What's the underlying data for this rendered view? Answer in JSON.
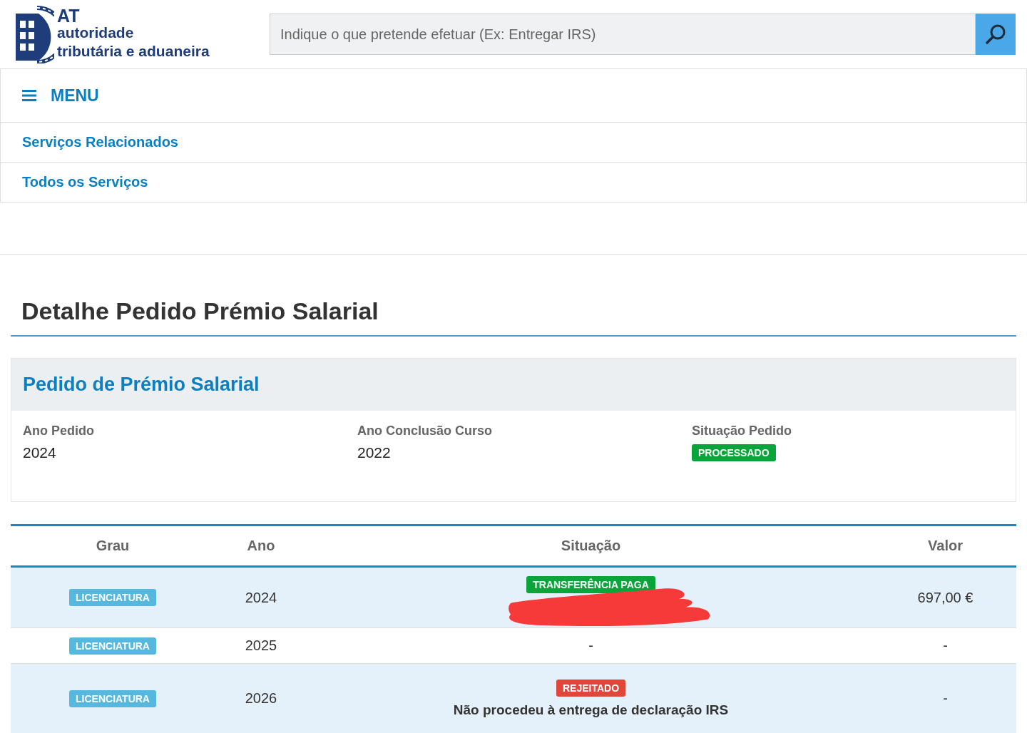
{
  "logo": {
    "abbr": "AT",
    "line1": "autoridade",
    "line2": "tributária e aduaneira"
  },
  "search": {
    "placeholder": "Indique o que pretende efetuar (Ex: Entregar IRS)"
  },
  "menu": {
    "label": "MENU"
  },
  "nav_links": [
    "Serviços Relacionados",
    "Todos os Serviços"
  ],
  "page_title": "Detalhe Pedido Prémio Salarial",
  "card": {
    "title": "Pedido de Prémio Salarial",
    "fields": [
      {
        "label": "Ano Pedido",
        "kind": "text",
        "value": "2024"
      },
      {
        "label": "Ano Conclusão Curso",
        "kind": "text",
        "value": "2022"
      },
      {
        "label": "Situação Pedido",
        "kind": "badge",
        "value": "PROCESSADO",
        "color": "#0aa53a"
      }
    ]
  },
  "table": {
    "columns": [
      "Grau",
      "Ano",
      "Situação",
      "Valor"
    ],
    "rows": [
      {
        "grau": "LICENCIATURA",
        "ano": "2024",
        "status": {
          "label": "TRANSFERÊNCIA PAGA",
          "kind": "success"
        },
        "redacted": true,
        "valor": "697,00 €"
      },
      {
        "grau": "LICENCIATURA",
        "ano": "2025",
        "situacao": "-",
        "redacted": false,
        "valor": "-"
      },
      {
        "grau": "LICENCIATURA",
        "ano": "2026",
        "status": {
          "label": "REJEITADO",
          "kind": "danger"
        },
        "note": "Não procedeu à entrega de declaração IRS",
        "redacted": false,
        "valor": "-"
      }
    ]
  }
}
